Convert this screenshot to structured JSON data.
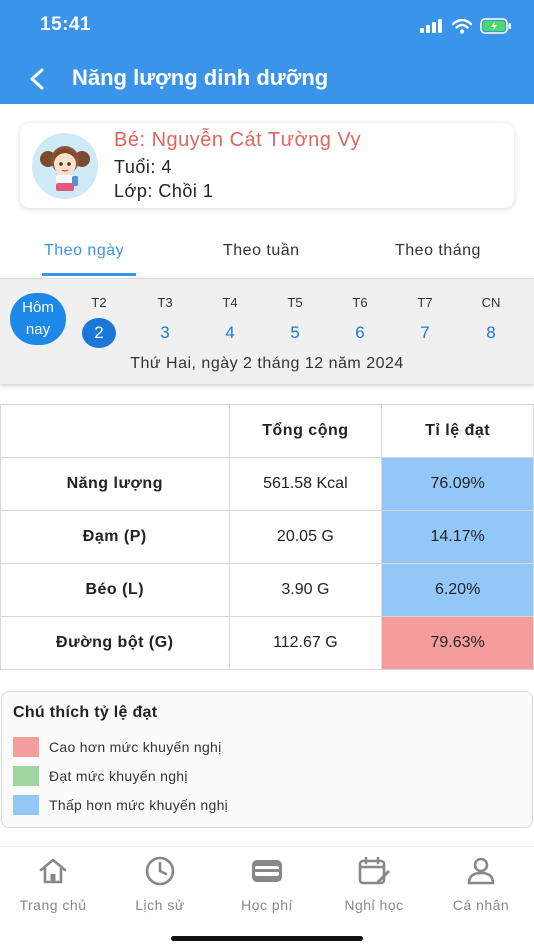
{
  "status_bar": {
    "time": "15:41"
  },
  "header": {
    "title": "Năng lượng dinh dưỡng"
  },
  "profile": {
    "name": "Bé: Nguyễn Cát Tường  Vy",
    "age": "Tuổi: 4",
    "class": "Lớp: Chồi 1"
  },
  "tabs": [
    {
      "label": "Theo ngày",
      "active": true
    },
    {
      "label": "Theo tuần",
      "active": false
    },
    {
      "label": "Theo tháng",
      "active": false
    }
  ],
  "week": {
    "today_label": "Hôm nay",
    "days": [
      {
        "label": "T2",
        "num": "2",
        "selected": true
      },
      {
        "label": "T3",
        "num": "3"
      },
      {
        "label": "T4",
        "num": "4"
      },
      {
        "label": "T5",
        "num": "5"
      },
      {
        "label": "T6",
        "num": "6"
      },
      {
        "label": "T7",
        "num": "7"
      },
      {
        "label": "CN",
        "num": "8"
      }
    ],
    "date_text": "Thứ Hai, ngày 2 tháng 12 năm 2024"
  },
  "table": {
    "headers": [
      "",
      "Tổng cộng",
      "Tỉ lệ đạt"
    ],
    "rows": [
      {
        "name": "Năng lượng",
        "total": "561.58 Kcal",
        "ratio": "76.09%",
        "status": "low"
      },
      {
        "name": "Đạm (P)",
        "total": "20.05 G",
        "ratio": "14.17%",
        "status": "low"
      },
      {
        "name": "Béo (L)",
        "total": "3.90 G",
        "ratio": "6.20%",
        "status": "low"
      },
      {
        "name": "Đường bột (G)",
        "total": "112.67 G",
        "ratio": "79.63%",
        "status": "high"
      }
    ]
  },
  "legend": {
    "title": "Chú thích tỷ lệ đạt",
    "items": [
      {
        "label": "Cao hơn mức khuyến nghị",
        "color": "#f59c9c"
      },
      {
        "label": "Đạt mức khuyến nghị",
        "color": "#9fd6a0"
      },
      {
        "label": "Thấp hơn mức khuyến nghị",
        "color": "#93c7f7"
      }
    ]
  },
  "bottom_nav": [
    {
      "label": "Trang chủ",
      "icon": "home-icon"
    },
    {
      "label": "Lịch sử",
      "icon": "clock-icon"
    },
    {
      "label": "Học phí",
      "icon": "wallet-icon"
    },
    {
      "label": "Nghỉ học",
      "icon": "calendar-edit-icon"
    },
    {
      "label": "Cá nhân",
      "icon": "person-icon"
    }
  ],
  "colors": {
    "primary": "#3a95ea",
    "high": "#f59c9c",
    "normal": "#9fd6a0",
    "low": "#93c7f7",
    "name": "#e0655f"
  }
}
